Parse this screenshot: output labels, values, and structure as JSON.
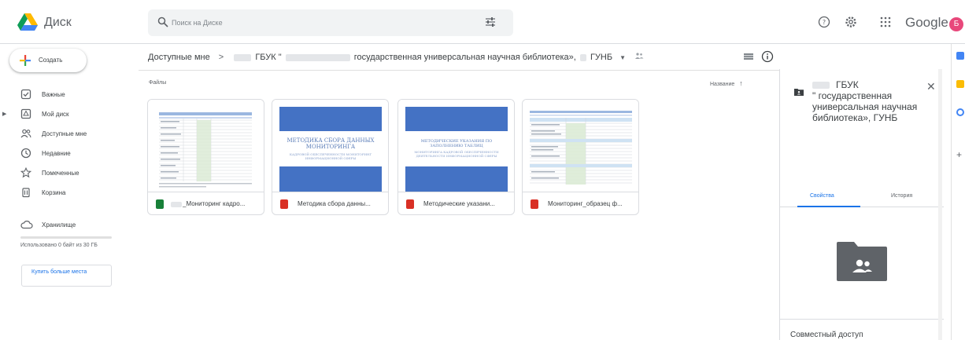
{
  "app": {
    "title": "Диск",
    "account_word": "Google",
    "avatar_letter": "Б"
  },
  "search": {
    "placeholder": "Поиск на Диске"
  },
  "sidebar": {
    "create_label": "Создать",
    "items": [
      {
        "label": "Важные",
        "icon": "check-box-icon"
      },
      {
        "label": "Мой диск",
        "icon": "drive-icon",
        "expandable": true
      },
      {
        "label": "Доступные мне",
        "icon": "people-icon"
      },
      {
        "label": "Недавние",
        "icon": "clock-icon"
      },
      {
        "label": "Помеченные",
        "icon": "star-icon"
      },
      {
        "label": "Корзина",
        "icon": "trash-icon"
      }
    ],
    "storage_label": "Хранилище",
    "quota_text": "Использовано 0 байт из 30 ГБ",
    "quota_fraction": 0.0,
    "buy_label": "Купить больше места"
  },
  "breadcrumb": {
    "root": "Доступные мне",
    "separator": ">",
    "folder_prefix": "ГБУК \"",
    "folder_middle": "государственная универсальная научная библиотека»,",
    "folder_suffix": "ГУНБ"
  },
  "main": {
    "files_label": "Файлы",
    "sort_label": "Название",
    "sort_arrow": "↑",
    "files": [
      {
        "name": "_Мониторинг кадро...",
        "type": "sheet",
        "type_color": "#188038"
      },
      {
        "name": "Методика сбора данны...",
        "type": "pdf",
        "type_color": "#d93025",
        "thumb_title": "МЕТОДИКА СБОРА ДАННЫХ МОНИТОРИНГА",
        "thumb_sub": "КАДРОВОЙ ОБЕСПЕЧЕННОСТИ МОНИТОРИНГ ИНФОРМАЦИОННОЙ СФЕРЫ"
      },
      {
        "name": "Методические указани...",
        "type": "pdf",
        "type_color": "#d93025",
        "thumb_title": "МЕТОДИЧЕСКИЕ УКАЗАНИЯ ПО ЗАПОЛНЕНИЮ ТАБЛИЦ",
        "thumb_sub": "МОНИТОРИНГА КАДРОВОЙ ОБЕСПЕЧЕННОСТИ ДЕЯТЕЛЬНОСТИ ИНФОРМАЦИОННОЙ СФЕРЫ"
      },
      {
        "name": "Мониторинг_образец ф...",
        "type": "pdf",
        "type_color": "#d93025"
      }
    ]
  },
  "details": {
    "title_line1": "ГБУК",
    "title_rest": "\" государственная универсальная научная библиотека», ГУНБ",
    "tab_properties": "Свойства",
    "tab_history": "История",
    "share_label": "Совместный доступ"
  },
  "colors": {
    "accent": "#1a73e8",
    "folder_dark": "#5f6368"
  }
}
